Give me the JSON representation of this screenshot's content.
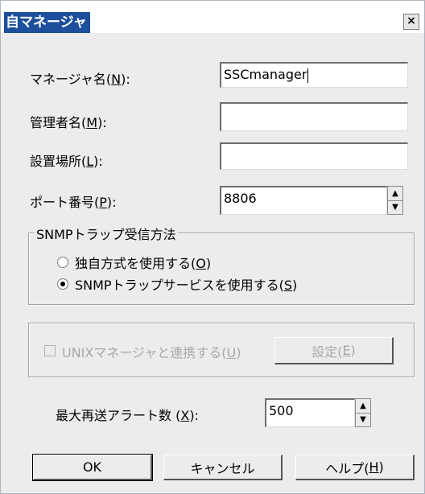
{
  "window": {
    "title": "自マネージャ",
    "close_label": "×"
  },
  "fields": {
    "manager_name": {
      "label": "マネージャ名(",
      "key": "N",
      "suffix": "):",
      "value": "SSCmanager"
    },
    "admin_name": {
      "label": "管理者名(",
      "key": "M",
      "suffix": "):",
      "value": ""
    },
    "location": {
      "label": "設置場所(",
      "key": "L",
      "suffix": "):",
      "value": ""
    },
    "port": {
      "label": "ポート番号(",
      "key": "P",
      "suffix": "):",
      "value": "8806"
    }
  },
  "trap_group": {
    "legend": "SNMPトラップ受信方法",
    "option_own": {
      "label": "独自方式を使用する(",
      "key": "O",
      "suffix": ")",
      "selected": false
    },
    "option_service": {
      "label": "SNMPトラップサービスを使用する(",
      "key": "S",
      "suffix": ")",
      "selected": true
    }
  },
  "unix_group": {
    "checkbox": {
      "label": "UNIXマネージャと連携する(",
      "key": "U",
      "suffix": ")",
      "checked": false,
      "enabled": false
    },
    "settings_button": {
      "label": "設定(",
      "key": "E",
      "suffix": ")",
      "enabled": false
    }
  },
  "retry": {
    "label": "最大再送アラート数 (",
    "key": "X",
    "suffix": "):",
    "value": "500"
  },
  "buttons": {
    "ok": {
      "label": "OK"
    },
    "cancel": {
      "label": "キャンセル"
    },
    "help": {
      "label": "ヘルプ(",
      "key": "H",
      "suffix": ")"
    }
  }
}
